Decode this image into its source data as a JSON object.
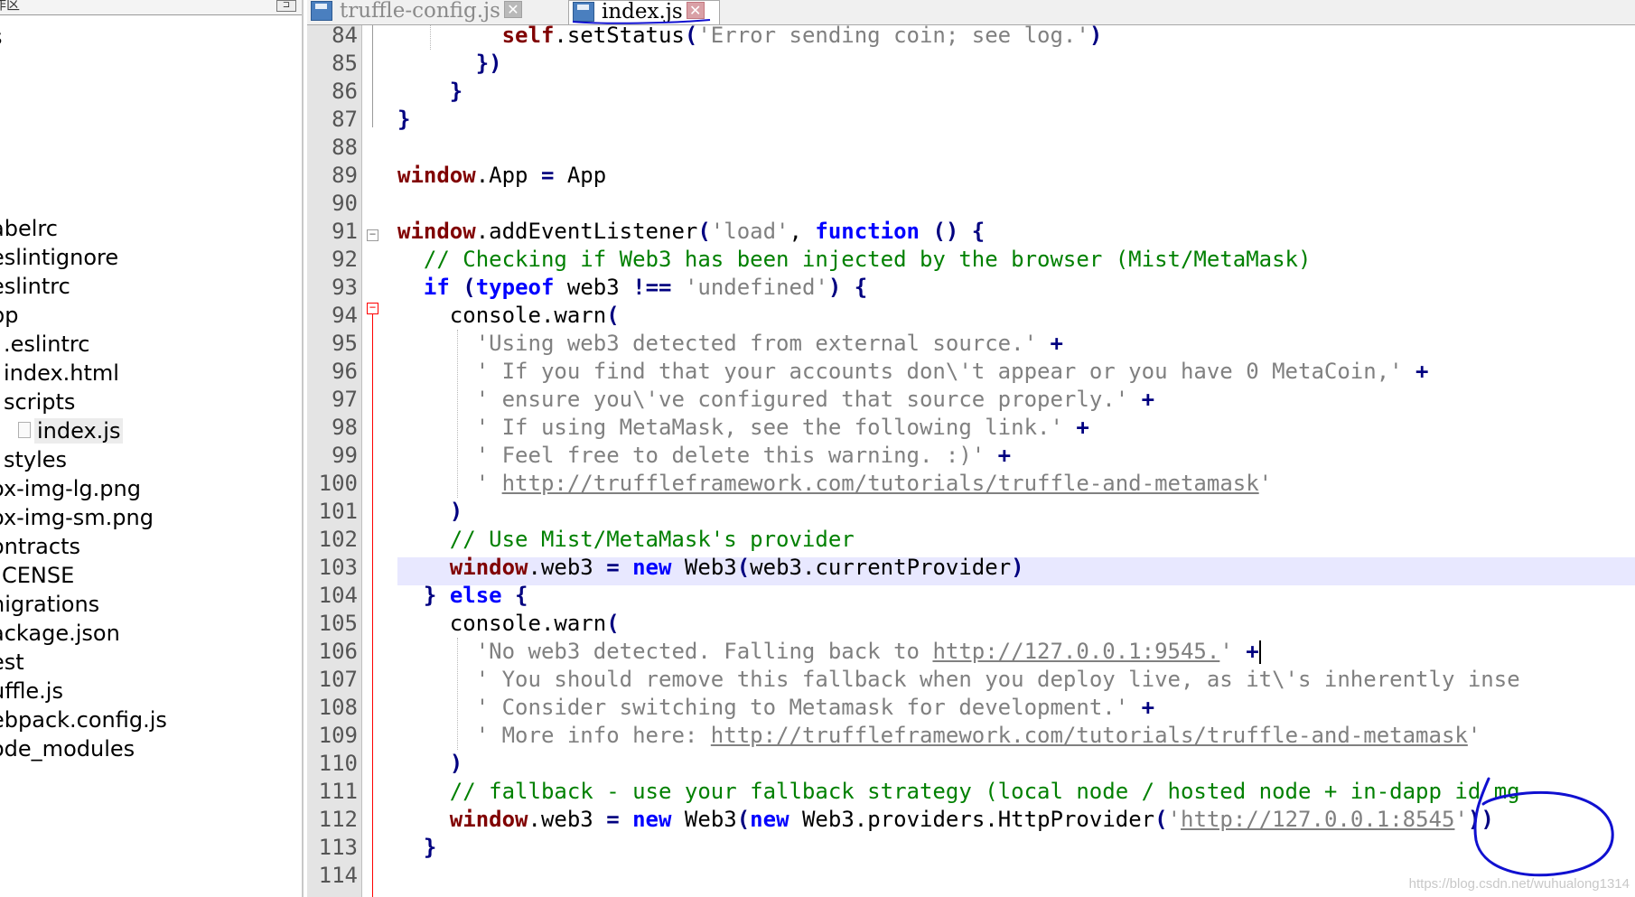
{
  "tree": {
    "header_title": "作区",
    "items": [
      {
        "label": "s",
        "selected": false
      },
      {
        "label": "abelrc",
        "selected": false
      },
      {
        "label": "eslintignore",
        "selected": false
      },
      {
        "label": "eslintrc",
        "selected": false
      },
      {
        "label": "pp",
        "selected": false
      },
      {
        "label": ".eslintrc",
        "selected": false
      },
      {
        "label": "index.html",
        "selected": false
      },
      {
        "label": "scripts",
        "selected": false
      },
      {
        "label": "index.js",
        "selected": true
      },
      {
        "label": "styles",
        "selected": false
      },
      {
        "label": "ox-img-lg.png",
        "selected": false
      },
      {
        "label": "ox-img-sm.png",
        "selected": false
      },
      {
        "label": "ontracts",
        "selected": false
      },
      {
        "label": "CENSE",
        "selected": false
      },
      {
        "label": "nigrations",
        "selected": false
      },
      {
        "label": "ackage.json",
        "selected": false
      },
      {
        "label": "est",
        "selected": false
      },
      {
        "label": "uffle.js",
        "selected": false
      },
      {
        "label": "ebpack.config.js",
        "selected": false
      },
      {
        "label": "ode_modules",
        "selected": false
      }
    ]
  },
  "tabs": [
    {
      "label": "truffle-config.js",
      "active": false
    },
    {
      "label": "index.js",
      "active": true
    }
  ],
  "editor": {
    "line_numbers": [
      "84",
      "85",
      "86",
      "87",
      "88",
      "89",
      "90",
      "91",
      "92",
      "93",
      "94",
      "95",
      "96",
      "97",
      "98",
      "99",
      "100",
      "101",
      "102",
      "103",
      "104",
      "105",
      "106",
      "107",
      "108",
      "109",
      "110",
      "111",
      "112",
      "113",
      "114"
    ],
    "current_line": "106"
  },
  "code": {
    "l84": {
      "a": "        ",
      "b": "self",
      "c": ".setStatus",
      "d": "(",
      "e": "'Error sending coin; see log.'",
      "f": ")"
    },
    "l85": {
      "a": "      ",
      "b": "})"
    },
    "l86": {
      "a": "    ",
      "b": "}"
    },
    "l87": {
      "a": "",
      "b": "}"
    },
    "l89": {
      "a": "window",
      "b": ".App ",
      "c": "=",
      "d": " App"
    },
    "l91": {
      "a": "window",
      "b": ".addEventListener",
      "c": "(",
      "d": "'load'",
      "e": ", ",
      "f": "function",
      "g": " () {"
    },
    "l92": {
      "a": "  ",
      "b": "// Checking if Web3 has been injected by the browser (Mist/MetaMask)"
    },
    "l93": {
      "a": "  ",
      "b": "if",
      "c": " (",
      "d": "typeof",
      "e": " web3 ",
      "f": "!==",
      "g": " ",
      "h": "'undefined'",
      "i": ") {"
    },
    "l94": {
      "a": "    console.warn",
      "b": "("
    },
    "l95": {
      "a": "      ",
      "b": "'Using web3 detected from external source.'",
      "c": " +"
    },
    "l96": {
      "a": "      ",
      "b": "' If you find that your accounts don\\'t appear or you have 0 MetaCoin,'",
      "c": " +"
    },
    "l97": {
      "a": "      ",
      "b": "' ensure you\\'ve configured that source properly.'",
      "c": " +"
    },
    "l98": {
      "a": "      ",
      "b": "' If using MetaMask, see the following link.'",
      "c": " +"
    },
    "l99": {
      "a": "      ",
      "b": "' Feel free to delete this warning. :)'",
      "c": " +"
    },
    "l100": {
      "a": "      ",
      "b": "' ",
      "c": "http://truffleframework.com/tutorials/truffle-and-metamask",
      "d": "'"
    },
    "l101": {
      "a": "    ",
      "b": ")"
    },
    "l102": {
      "a": "    ",
      "b": "// Use Mist/MetaMask's provider"
    },
    "l103": {
      "a": "    ",
      "b": "window",
      "c": ".web3 ",
      "d": "=",
      "e": " ",
      "f": "new",
      "g": " Web3",
      "h": "(",
      "i": "web3.currentProvider",
      "j": ")"
    },
    "l104": {
      "a": "  ",
      "b": "}",
      "c": " ",
      "d": "else",
      "e": " {"
    },
    "l105": {
      "a": "    console.warn",
      "b": "("
    },
    "l106": {
      "a": "      ",
      "b": "'No web3 detected. Falling back to ",
      "c": "http://127.0.0.1:9545.",
      "d": "'",
      "e": " +"
    },
    "l107": {
      "a": "      ",
      "b": "' You should remove this fallback when you deploy live, as it\\'s inherently inse"
    },
    "l108": {
      "a": "      ",
      "b": "' Consider switching to Metamask for development.'",
      "c": " +"
    },
    "l109": {
      "a": "      ",
      "b": "' More info here: ",
      "c": "http://truffleframework.com/tutorials/truffle-and-metamask",
      "d": "'"
    },
    "l110": {
      "a": "    ",
      "b": ")"
    },
    "l111": {
      "a": "    ",
      "b": "// fallback - use your fallback strategy (local node / hosted node + in-dapp id mg"
    },
    "l112": {
      "a": "    ",
      "b": "window",
      "c": ".web3 ",
      "d": "=",
      "e": " ",
      "f": "new",
      "g": " Web3",
      "h": "(",
      "i": "new",
      "j": " Web3.providers.HttpProvider",
      "k": "(",
      "l": "'",
      "m": "http://127.0.0.1:8545",
      "n": "'",
      "o": "))"
    },
    "l113": {
      "a": "  ",
      "b": "}"
    }
  },
  "watermark": "https://blog.csdn.net/wuhualong1314",
  "colors": {
    "keyword": "#0000ff",
    "string": "#808080",
    "comment": "#008000",
    "identifier": "#800000",
    "current_line_bg": "#e8e8ff",
    "fold_marker": "#ff0000",
    "annotation_ink": "#1010d0"
  },
  "icons": [
    "save-icon",
    "close-icon",
    "file-icon",
    "fold-minus-icon",
    "pin-icon"
  ]
}
